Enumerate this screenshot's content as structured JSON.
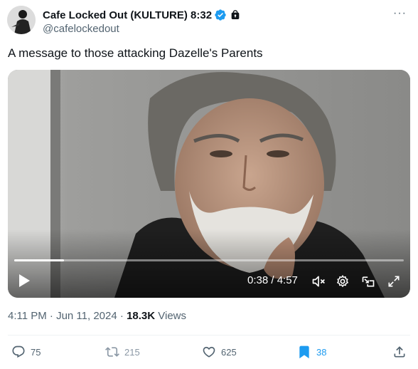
{
  "author": {
    "display_name": "Cafe Locked Out (KULTURE) 8:32",
    "handle": "@cafelockedout",
    "verified_color": "#1d9bf0"
  },
  "more_label": "···",
  "tweet": {
    "text": "A message to those attacking Dazelle's Parents"
  },
  "video": {
    "time_display": "0:38 / 4:57",
    "progress": 0.128
  },
  "meta": {
    "timestamp": "4:11 PM · Jun 11, 2024",
    "separator": " · ",
    "views_count": "18.3K",
    "views_label": " Views"
  },
  "actions": {
    "replies": "75",
    "reposts": "215",
    "likes": "625",
    "bookmarks": "38"
  },
  "colors": {
    "accent": "#1d9bf0",
    "text_primary": "#0f1419",
    "text_secondary": "#536471"
  }
}
